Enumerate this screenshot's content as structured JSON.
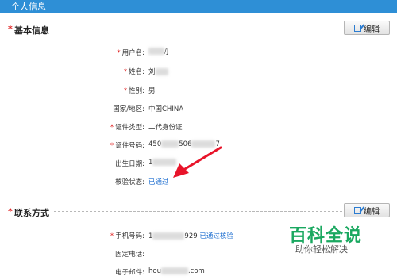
{
  "window": {
    "title": "个人信息"
  },
  "basic": {
    "title": "基本信息",
    "edit_label": "编辑",
    "fields": {
      "username": {
        "label": "用户名:",
        "value_suffix": "/J"
      },
      "name": {
        "label": "姓名:",
        "value_prefix": "刘"
      },
      "gender": {
        "label": "性别:",
        "value": "男"
      },
      "country": {
        "label": "国家/地区:",
        "value": "中国CHINA"
      },
      "id_type": {
        "label": "证件类型:",
        "value": "二代身份证"
      },
      "id_number": {
        "label": "证件号码:",
        "value_a": "450",
        "value_b": "506",
        "value_c": "7"
      },
      "birth": {
        "label": "出生日期:",
        "value_prefix": "1"
      },
      "verify": {
        "label": "核验状态:",
        "value": "已通过"
      }
    }
  },
  "contact": {
    "title": "联系方式",
    "edit_label": "编辑",
    "fields": {
      "mobile": {
        "label": "手机号码:",
        "value_prefix": "1",
        "value_suffix": "929",
        "status": "已通过核验"
      },
      "phone": {
        "label": "固定电话:"
      },
      "email": {
        "label": "电子邮件:",
        "value_prefix": "hou",
        "value_suffix": ".com"
      }
    }
  },
  "watermark": {
    "brand": "百科全说",
    "slogan": "助你轻松解决"
  },
  "colors": {
    "header": "#2e8fd6",
    "required": "#e02020",
    "link": "#1f6fd0",
    "arrow": "#e8142a"
  }
}
